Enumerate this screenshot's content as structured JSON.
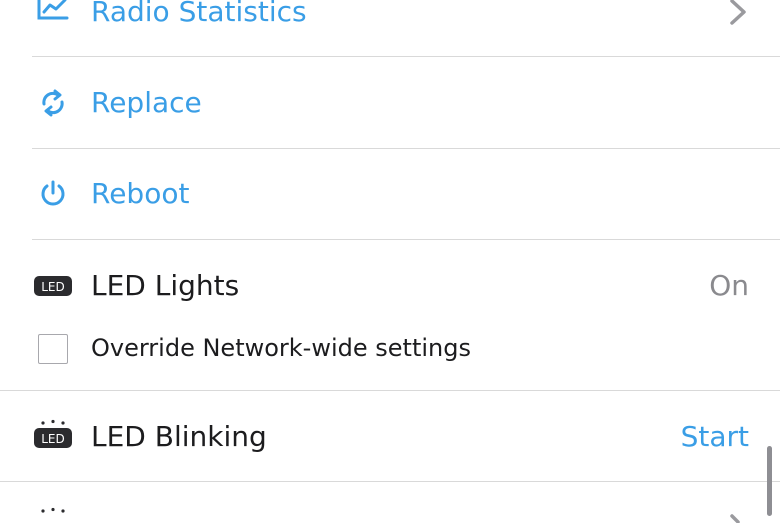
{
  "menu": {
    "radio_statistics": {
      "label": "Radio Statistics",
      "icon": "chart-line-icon"
    },
    "replace": {
      "label": "Replace",
      "icon": "swap-icon"
    },
    "reboot": {
      "label": "Reboot",
      "icon": "power-icon"
    },
    "led_lights": {
      "label": "LED Lights",
      "value": "On",
      "icon": "led-icon",
      "override": {
        "label": "Override Network-wide settings",
        "checked": false
      }
    },
    "led_blinking": {
      "label": "LED Blinking",
      "action": "Start",
      "icon": "led-blink-icon"
    }
  },
  "colors": {
    "accent": "#3a9ee6",
    "text": "#1c1c1e",
    "secondary": "#8a8a8e",
    "divider": "#d9d9d9"
  }
}
